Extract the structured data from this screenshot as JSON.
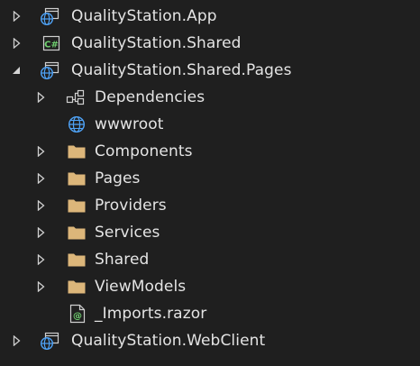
{
  "tree": {
    "items": [
      {
        "label": "QualityStation.App",
        "icon": "web-project-icon",
        "expander": "collapsed",
        "level": 0
      },
      {
        "label": "QualityStation.Shared",
        "icon": "csharp-project-icon",
        "expander": "collapsed",
        "level": 0
      },
      {
        "label": "QualityStation.Shared.Pages",
        "icon": "web-project-icon",
        "expander": "expanded",
        "level": 0
      },
      {
        "label": "Dependencies",
        "icon": "dependencies-icon",
        "expander": "collapsed",
        "level": 1
      },
      {
        "label": "wwwroot",
        "icon": "globe-icon",
        "expander": "none",
        "level": 1
      },
      {
        "label": "Components",
        "icon": "folder-icon",
        "expander": "collapsed",
        "level": 1
      },
      {
        "label": "Pages",
        "icon": "folder-icon",
        "expander": "collapsed",
        "level": 1
      },
      {
        "label": "Providers",
        "icon": "folder-icon",
        "expander": "collapsed",
        "level": 1
      },
      {
        "label": "Services",
        "icon": "folder-icon",
        "expander": "collapsed",
        "level": 1
      },
      {
        "label": "Shared",
        "icon": "folder-icon",
        "expander": "collapsed",
        "level": 1
      },
      {
        "label": "ViewModels",
        "icon": "folder-icon",
        "expander": "collapsed",
        "level": 1
      },
      {
        "label": "_Imports.razor",
        "icon": "razor-file-icon",
        "expander": "none",
        "level": 1
      },
      {
        "label": "QualityStation.WebClient",
        "icon": "web-project-icon",
        "expander": "collapsed",
        "level": 0
      }
    ]
  },
  "colors": {
    "background": "#1f1f1f",
    "text": "#e4e4e4",
    "folder": "#dcb67a",
    "globe": "#4fa3f7",
    "csharp": "#6fcf6f"
  }
}
